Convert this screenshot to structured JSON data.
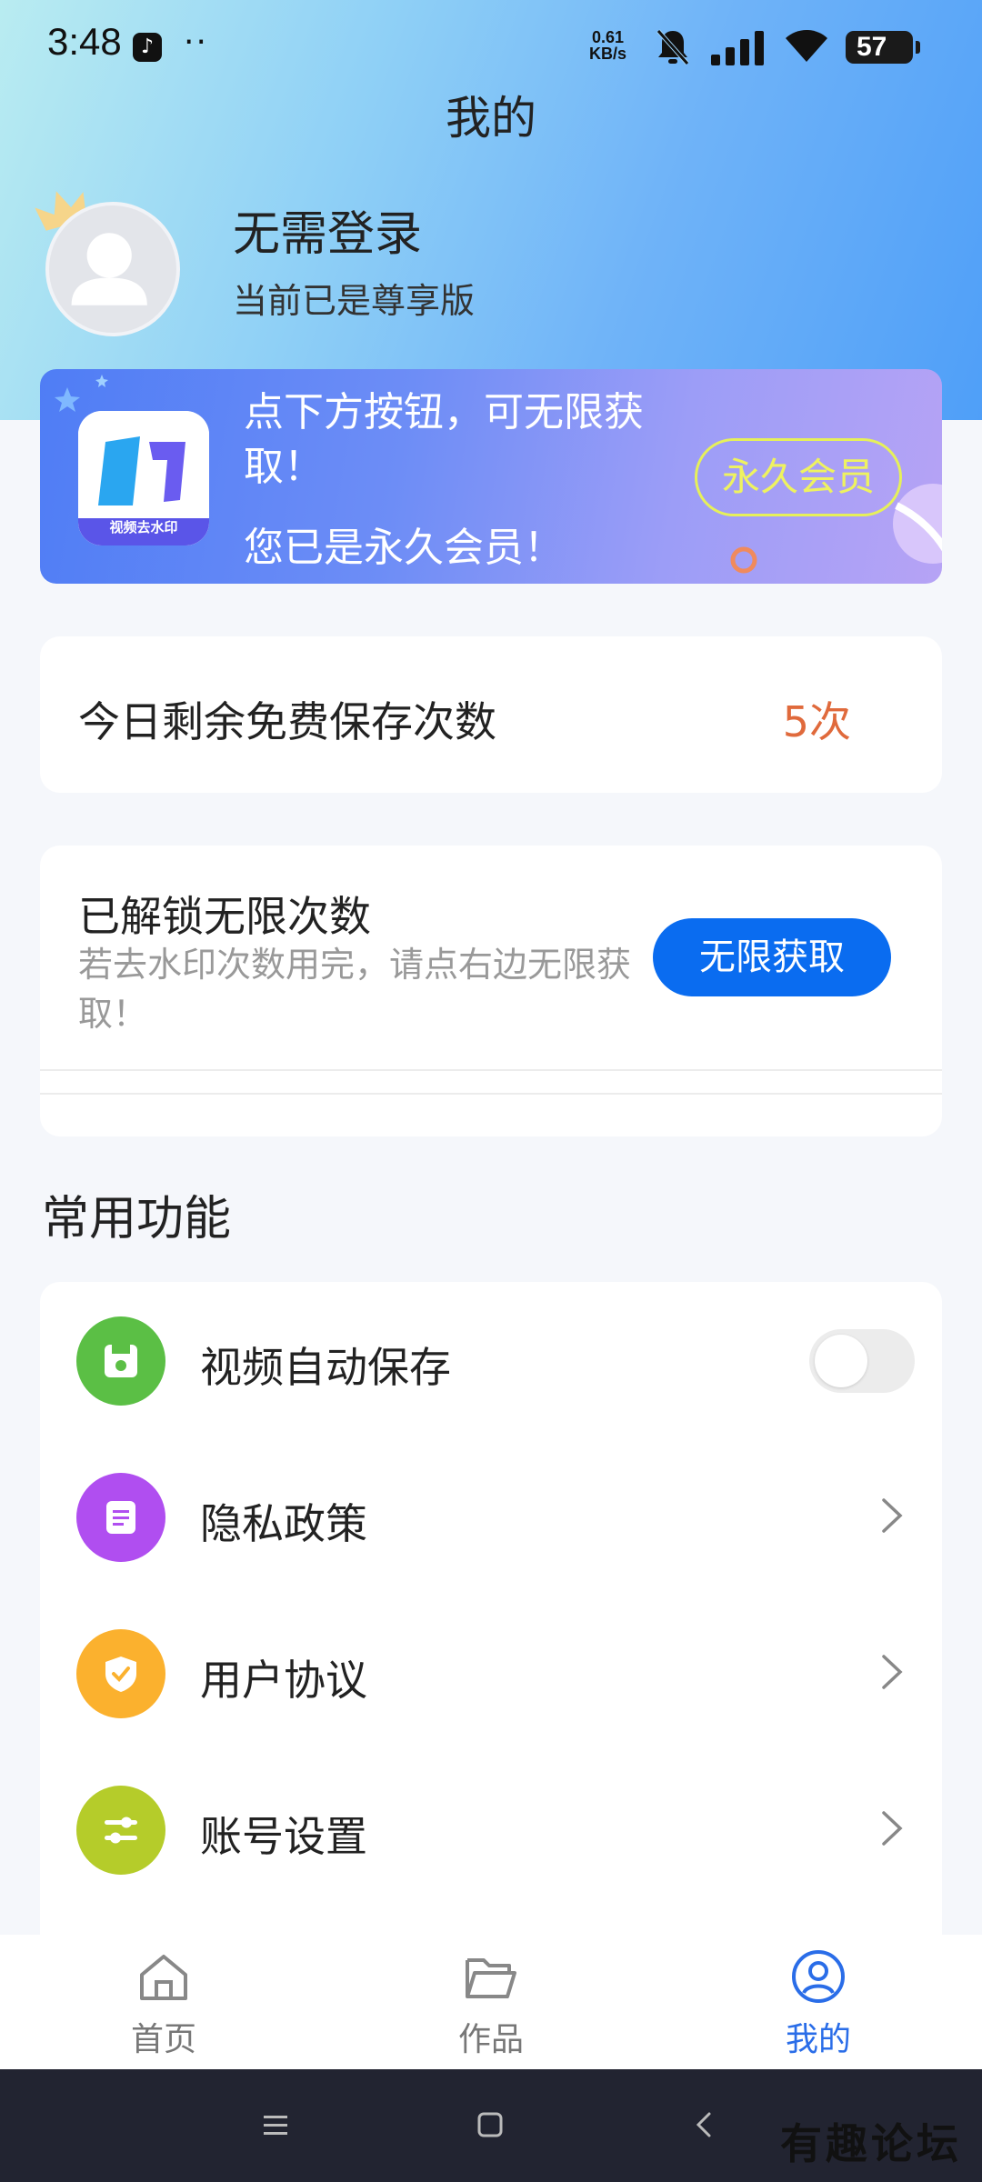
{
  "status_bar": {
    "time": "3:48",
    "net_speed_value": "0.61",
    "net_speed_unit": "KB/s",
    "battery": "57",
    "icons": [
      "tiktok-icon",
      "bell-off-icon",
      "signal-icon",
      "wifi-icon",
      "battery-icon"
    ]
  },
  "header": {
    "title": "我的"
  },
  "profile": {
    "name": "无需登录",
    "subtitle": "当前已是尊享版"
  },
  "banner": {
    "logo_label": "视频去水印",
    "line1": "点下方按钮，可无限获取！",
    "line2": "您已是永久会员！",
    "badge": "永久会员"
  },
  "free_saves": {
    "label": "今日剩余免费保存次数",
    "count": "5次",
    "count_color": "#e06a3c"
  },
  "unlock": {
    "title": "已解锁无限次数",
    "description": "若去水印次数用完，请点右边无限获取！",
    "button": "无限获取",
    "button_color": "#0a6cf0"
  },
  "functions": {
    "section_title": "常用功能",
    "items": [
      {
        "label": "视频自动保存",
        "icon": "save-icon",
        "color": "#5bbf45",
        "control": "toggle",
        "on": false
      },
      {
        "label": "隐私政策",
        "icon": "document-icon",
        "color": "#b04ef0",
        "control": "chevron"
      },
      {
        "label": "用户协议",
        "icon": "shield-check-icon",
        "color": "#fbb12e",
        "control": "chevron"
      },
      {
        "label": "账号设置",
        "icon": "sliders-icon",
        "color": "#b5cc2a",
        "control": "chevron"
      }
    ]
  },
  "bottom_nav": {
    "items": [
      {
        "label": "首页",
        "icon": "home-icon",
        "active": false
      },
      {
        "label": "作品",
        "icon": "folder-icon",
        "active": false
      },
      {
        "label": "我的",
        "icon": "user-circle-icon",
        "active": true
      }
    ],
    "active_color": "#2a6de8"
  },
  "watermark": "有趣论坛"
}
